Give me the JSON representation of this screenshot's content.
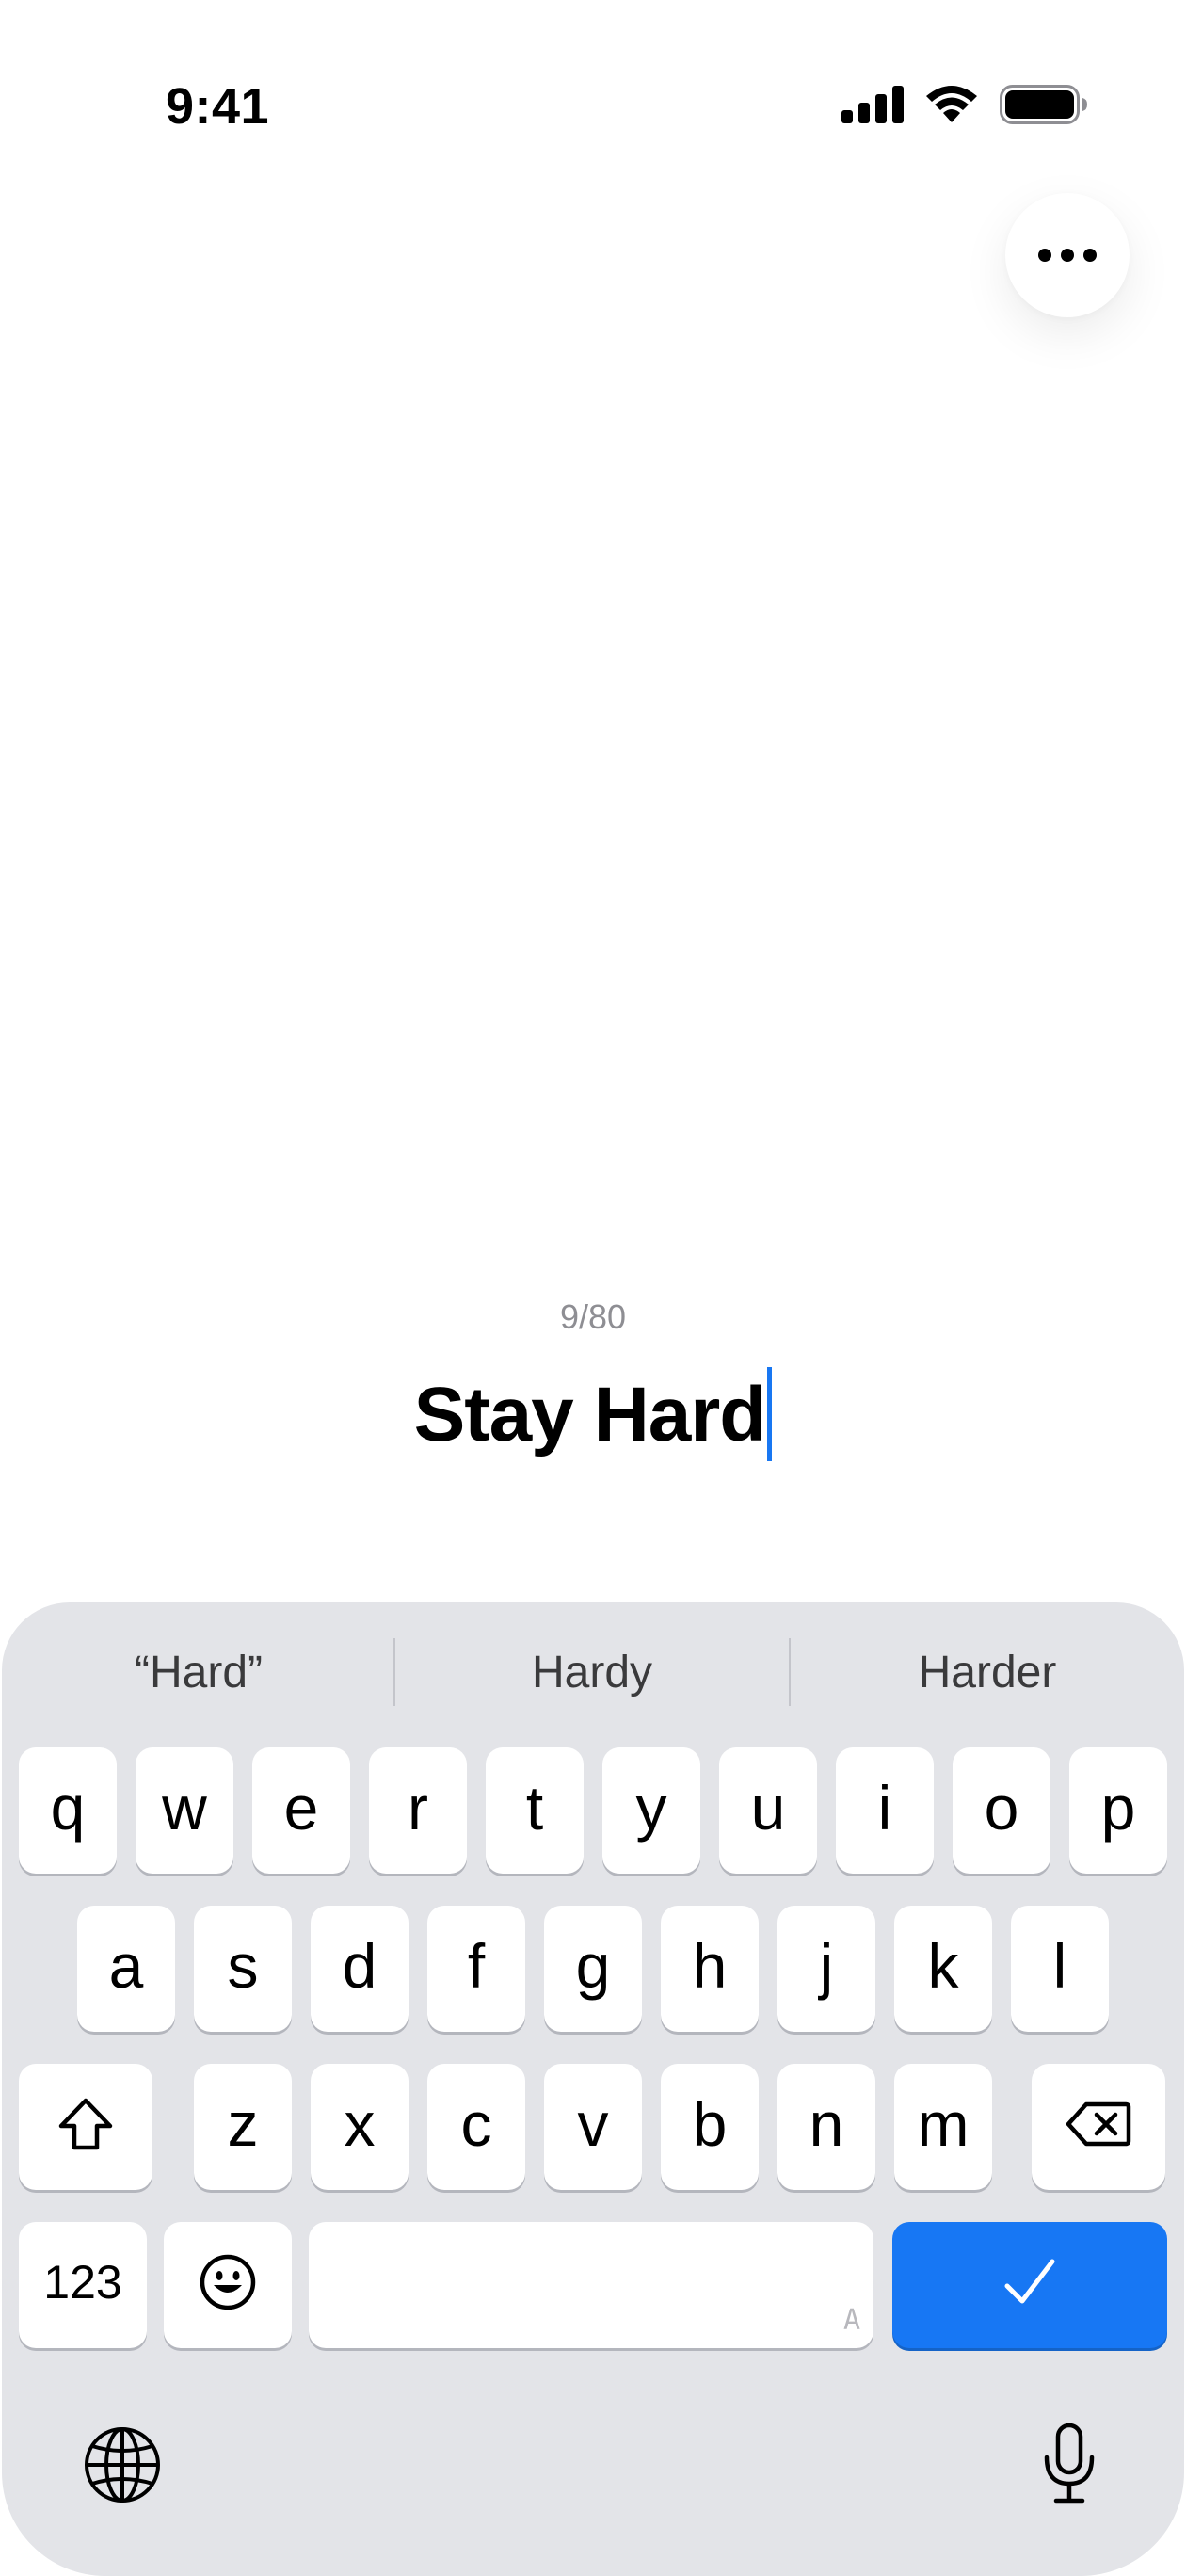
{
  "status_bar": {
    "time": "9:41"
  },
  "editor": {
    "counter": "9/80",
    "title_value": "Stay Hard"
  },
  "keyboard": {
    "suggestions": [
      "“Hard”",
      "Hardy",
      "Harder"
    ],
    "row1": [
      "q",
      "w",
      "e",
      "r",
      "t",
      "y",
      "u",
      "i",
      "o",
      "p"
    ],
    "row2": [
      "a",
      "s",
      "d",
      "f",
      "g",
      "h",
      "j",
      "k",
      "l"
    ],
    "row3": [
      "z",
      "x",
      "c",
      "v",
      "b",
      "n",
      "m"
    ],
    "numbers_key": "123",
    "space_tag": "A"
  },
  "colors": {
    "accent": "#1777f4",
    "caret": "#1877f2",
    "keyboard_bg": "#e3e4e8"
  },
  "icons": [
    "signal-icon",
    "wifi-icon",
    "battery-icon",
    "more-icon",
    "shift-icon",
    "backspace-icon",
    "emoji-icon",
    "checkmark-icon",
    "globe-icon",
    "microphone-icon"
  ]
}
